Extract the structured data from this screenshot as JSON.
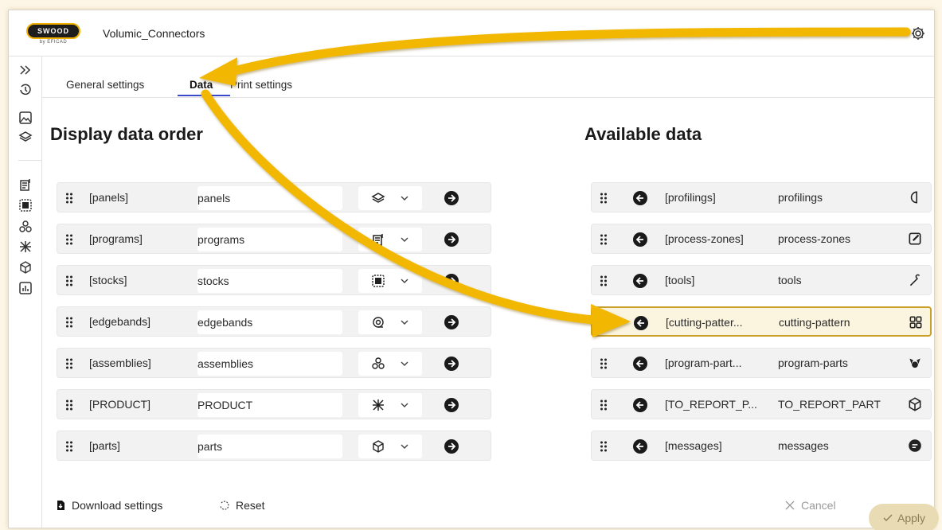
{
  "header": {
    "logo_text": "SWOOD",
    "logo_sub": "by EFICAD",
    "title": "Volumic_Connectors",
    "settings_icon": "gear-icon"
  },
  "sidebar": {
    "icons": [
      "expand-icon",
      "history-icon",
      "image-icon",
      "layers-icon",
      "document-icon",
      "stock-icon",
      "assembly-icon",
      "product-icon",
      "cube-icon",
      "report-icon"
    ]
  },
  "tabs": [
    {
      "label": "General settings",
      "active": false
    },
    {
      "label": "Data",
      "active": true
    },
    {
      "label": "Print settings",
      "active": false
    }
  ],
  "left": {
    "title": "Display data order",
    "rows": [
      {
        "key": "[panels]",
        "value": "panels",
        "icon": "layers-icon"
      },
      {
        "key": "[programs]",
        "value": "programs",
        "icon": "document-icon"
      },
      {
        "key": "[stocks]",
        "value": "stocks",
        "icon": "stock-icon"
      },
      {
        "key": "[edgebands]",
        "value": "edgebands",
        "icon": "edgeband-icon"
      },
      {
        "key": "[assemblies]",
        "value": "assemblies",
        "icon": "assembly-icon"
      },
      {
        "key": "[PRODUCT]",
        "value": "PRODUCT",
        "icon": "product-icon"
      },
      {
        "key": "[parts]",
        "value": "parts",
        "icon": "cube-icon"
      }
    ]
  },
  "right": {
    "title": "Available data",
    "rows": [
      {
        "key": "[profilings]",
        "value": "profilings",
        "icon": "profiling-icon"
      },
      {
        "key": "[process-zones]",
        "value": "process-zones",
        "icon": "edit-icon"
      },
      {
        "key": "[tools]",
        "value": "tools",
        "icon": "tool-icon"
      },
      {
        "key": "[cutting-patter...",
        "value": "cutting-pattern",
        "icon": "grid-icon",
        "highlighted": true
      },
      {
        "key": "[program-part...",
        "value": "program-parts",
        "icon": "program-parts-icon"
      },
      {
        "key": "[TO_REPORT_P...",
        "value": "TO_REPORT_PART",
        "icon": "cube-icon"
      },
      {
        "key": "[messages]",
        "value": "messages",
        "icon": "message-icon"
      }
    ]
  },
  "footer": {
    "download": "Download settings",
    "reset": "Reset",
    "cancel": "Cancel",
    "apply": "Apply"
  },
  "colors": {
    "accent": "#3a49c9",
    "arrow": "#f2b705",
    "highlight_border": "#c9a12a"
  }
}
